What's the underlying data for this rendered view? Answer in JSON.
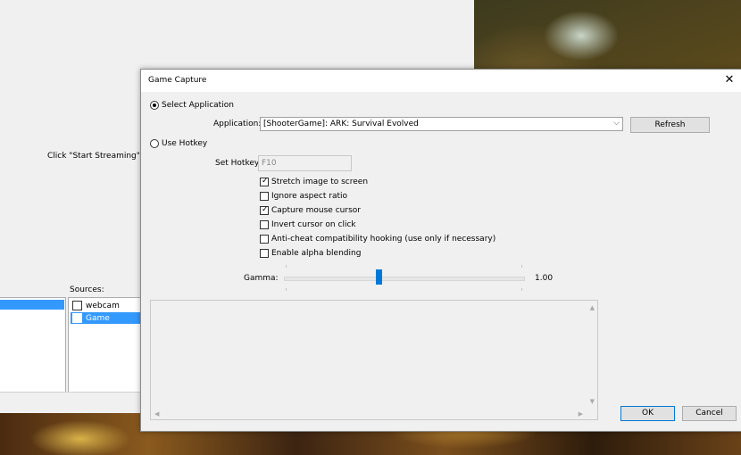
{
  "background": {
    "hint_text": "Click \"Start Streaming\", \"S",
    "sources_label": "Sources:",
    "sources": [
      {
        "label": "webcam",
        "checked": false,
        "selected": false
      },
      {
        "label": "Game",
        "checked": true,
        "selected": true
      }
    ]
  },
  "dialog": {
    "title": "Game Capture",
    "close_glyph": "✕",
    "select_application_label": "Select Application",
    "select_application_selected": true,
    "application_label": "Application:",
    "application_value": "[ShooterGame]: ARK: Survival Evolved",
    "refresh_label": "Refresh",
    "use_hotkey_label": "Use Hotkey",
    "use_hotkey_selected": false,
    "set_hotkey_label": "Set Hotkey",
    "hotkey_value": "F10",
    "options": [
      {
        "label": "Stretch image to screen",
        "checked": true
      },
      {
        "label": "Ignore aspect ratio",
        "checked": false
      },
      {
        "label": "Capture mouse cursor",
        "checked": true
      },
      {
        "label": "Invert cursor on click",
        "checked": false
      },
      {
        "label": "Anti-cheat compatibility hooking (use only if necessary)",
        "checked": false
      },
      {
        "label": "Enable alpha blending",
        "checked": false
      }
    ],
    "gamma_label": "Gamma:",
    "gamma_value": "1.00",
    "ok_label": "OK",
    "cancel_label": "Cancel"
  },
  "colors": {
    "accent": "#0078d7",
    "selection": "#3399ff",
    "window_bg": "#f0f0f0"
  },
  "icons": {
    "close": "close-icon",
    "dropdown": "chevron-down-icon",
    "check": "check-icon"
  }
}
